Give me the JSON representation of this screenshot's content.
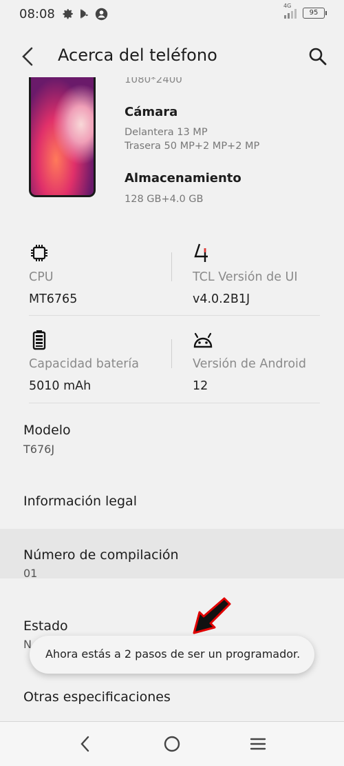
{
  "status_bar": {
    "time": "08:08",
    "network": "4G",
    "battery": "95",
    "icons": [
      "gear-icon",
      "play-store-icon",
      "account-icon",
      "signal-icon",
      "battery-icon"
    ]
  },
  "app_bar": {
    "title": "Acerca del teléfono",
    "icons": [
      "back-arrow-icon",
      "search-icon"
    ]
  },
  "specs": {
    "resolution_cut": "1080*2400",
    "camera": {
      "heading": "Cámara",
      "front": "Delantera  13 MP",
      "rear": "Trasera  50 MP+2 MP+2 MP"
    },
    "storage": {
      "heading": "Almacenamiento",
      "value": "128 GB+4.0 GB"
    }
  },
  "grid": [
    {
      "icon": "cpu-chip-icon",
      "label": "CPU",
      "value": "MT6765"
    },
    {
      "icon": "tcl-ui-icon",
      "label": "TCL Versión de UI",
      "value": "v4.0.2B1J"
    },
    {
      "icon": "battery-icon",
      "label": "Capacidad batería",
      "value": "5010 mAh"
    },
    {
      "icon": "android-icon",
      "label": "Versión de Android",
      "value": "12"
    }
  ],
  "list": {
    "model": {
      "title": "Modelo",
      "value": "T676J"
    },
    "legal": {
      "title": "Información legal"
    },
    "build": {
      "title": "Número de compilación",
      "value": "01"
    },
    "status": {
      "title": "Estado",
      "value_cut": "N"
    },
    "other": {
      "title": "Otras especificaciones"
    }
  },
  "toast": {
    "text": "Ahora estás a 2 pasos de ser un programador."
  },
  "nav_bar": {
    "icons": [
      "nav-back-icon",
      "nav-home-icon",
      "nav-menu-icon"
    ]
  },
  "colors": {
    "background": "#f1f1f1",
    "highlight": "#e6e6e6",
    "tcl_accent": "#e53935",
    "annotation_arrow": "#e00000"
  }
}
